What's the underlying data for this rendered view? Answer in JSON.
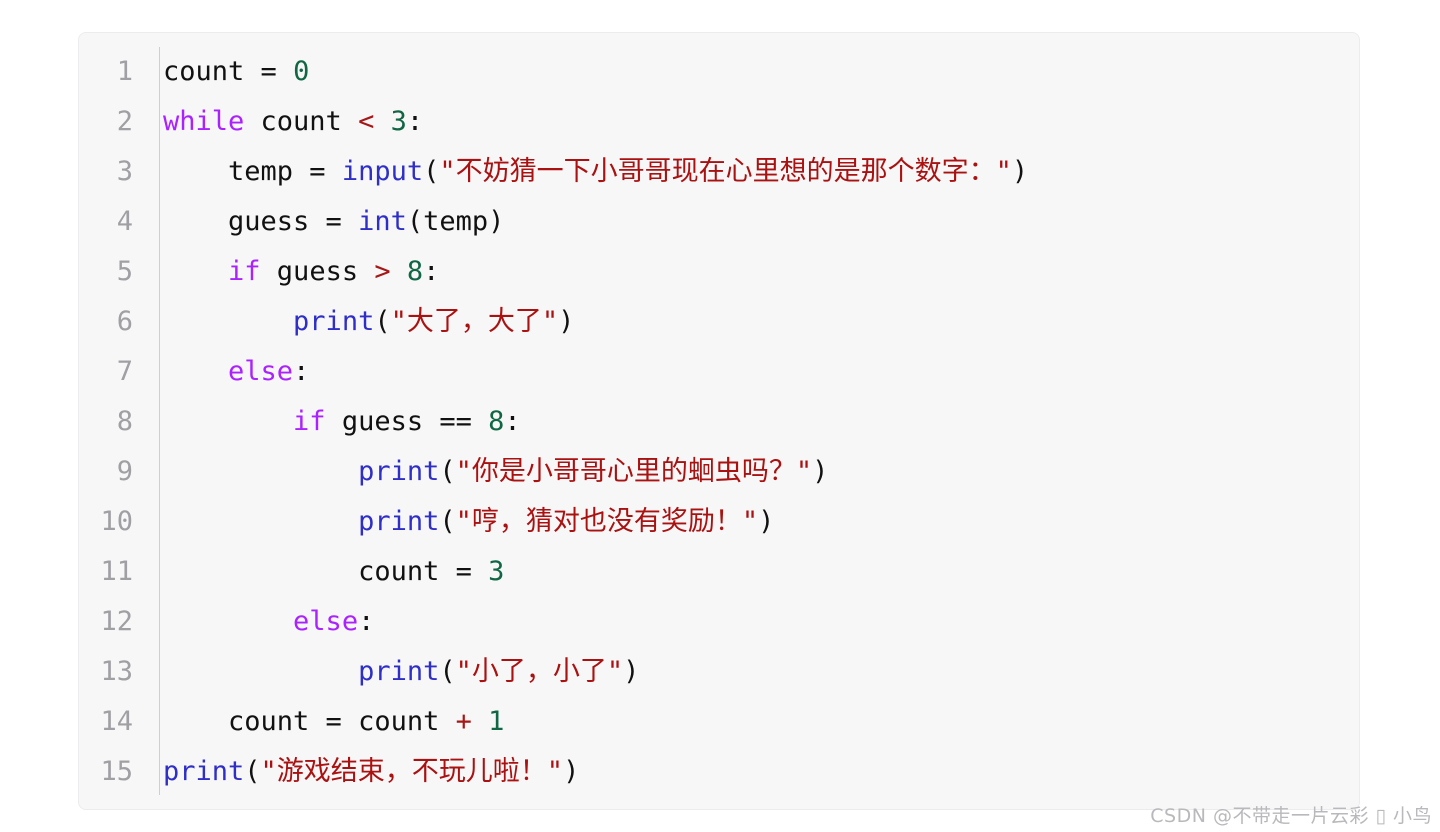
{
  "code_block": {
    "language": "python",
    "background": "#f7f7f8",
    "border_color": "#ececee",
    "gutter_divider_color": "#cfcfd2",
    "line_number_color": "#a0a0a4",
    "token_colors": {
      "keyword": "#aa22ff",
      "builtin": "#2f2fc7",
      "string": "#aa1111",
      "number": "#116644",
      "operator": "#a61717",
      "plain": "#111111"
    },
    "lines": [
      {
        "number": "1",
        "tokens": [
          {
            "t": "count",
            "k": "plain"
          },
          {
            "t": " ",
            "k": "plain"
          },
          {
            "t": "=",
            "k": "plain"
          },
          {
            "t": " ",
            "k": "plain"
          },
          {
            "t": "0",
            "k": "num"
          }
        ]
      },
      {
        "number": "2",
        "tokens": [
          {
            "t": "while",
            "k": "kw"
          },
          {
            "t": " count ",
            "k": "plain"
          },
          {
            "t": "<",
            "k": "op"
          },
          {
            "t": " ",
            "k": "plain"
          },
          {
            "t": "3",
            "k": "num"
          },
          {
            "t": ":",
            "k": "plain"
          }
        ]
      },
      {
        "number": "3",
        "tokens": [
          {
            "t": "    temp = ",
            "k": "plain"
          },
          {
            "t": "input",
            "k": "builtin"
          },
          {
            "t": "(",
            "k": "punc"
          },
          {
            "t": "\"不妨猜一下小哥哥现在心里想的是那个数字：\"",
            "k": "str"
          },
          {
            "t": ")",
            "k": "punc"
          }
        ]
      },
      {
        "number": "4",
        "tokens": [
          {
            "t": "    guess = ",
            "k": "plain"
          },
          {
            "t": "int",
            "k": "builtin"
          },
          {
            "t": "(temp)",
            "k": "punc"
          }
        ]
      },
      {
        "number": "5",
        "tokens": [
          {
            "t": "    ",
            "k": "plain"
          },
          {
            "t": "if",
            "k": "kw"
          },
          {
            "t": " guess ",
            "k": "plain"
          },
          {
            "t": ">",
            "k": "op"
          },
          {
            "t": " ",
            "k": "plain"
          },
          {
            "t": "8",
            "k": "num"
          },
          {
            "t": ":",
            "k": "plain"
          }
        ]
      },
      {
        "number": "6",
        "tokens": [
          {
            "t": "        ",
            "k": "plain"
          },
          {
            "t": "print",
            "k": "builtin"
          },
          {
            "t": "(",
            "k": "punc"
          },
          {
            "t": "\"大了，大了\"",
            "k": "str"
          },
          {
            "t": ")",
            "k": "punc"
          }
        ]
      },
      {
        "number": "7",
        "tokens": [
          {
            "t": "    ",
            "k": "plain"
          },
          {
            "t": "else",
            "k": "kw"
          },
          {
            "t": ":",
            "k": "plain"
          }
        ]
      },
      {
        "number": "8",
        "tokens": [
          {
            "t": "        ",
            "k": "plain"
          },
          {
            "t": "if",
            "k": "kw"
          },
          {
            "t": " guess ",
            "k": "plain"
          },
          {
            "t": "==",
            "k": "plain"
          },
          {
            "t": " ",
            "k": "plain"
          },
          {
            "t": "8",
            "k": "num"
          },
          {
            "t": ":",
            "k": "plain"
          }
        ]
      },
      {
        "number": "9",
        "tokens": [
          {
            "t": "            ",
            "k": "plain"
          },
          {
            "t": "print",
            "k": "builtin"
          },
          {
            "t": "(",
            "k": "punc"
          },
          {
            "t": "\"你是小哥哥心里的蛔虫吗？\"",
            "k": "str"
          },
          {
            "t": ")",
            "k": "punc"
          }
        ]
      },
      {
        "number": "10",
        "tokens": [
          {
            "t": "            ",
            "k": "plain"
          },
          {
            "t": "print",
            "k": "builtin"
          },
          {
            "t": "(",
            "k": "punc"
          },
          {
            "t": "\"哼，猜对也没有奖励！\"",
            "k": "str"
          },
          {
            "t": ")",
            "k": "punc"
          }
        ]
      },
      {
        "number": "11",
        "tokens": [
          {
            "t": "            count = ",
            "k": "plain"
          },
          {
            "t": "3",
            "k": "num"
          }
        ]
      },
      {
        "number": "12",
        "tokens": [
          {
            "t": "        ",
            "k": "plain"
          },
          {
            "t": "else",
            "k": "kw"
          },
          {
            "t": ":",
            "k": "plain"
          }
        ]
      },
      {
        "number": "13",
        "tokens": [
          {
            "t": "            ",
            "k": "plain"
          },
          {
            "t": "print",
            "k": "builtin"
          },
          {
            "t": "(",
            "k": "punc"
          },
          {
            "t": "\"小了，小了\"",
            "k": "str"
          },
          {
            "t": ")",
            "k": "punc"
          }
        ]
      },
      {
        "number": "14",
        "tokens": [
          {
            "t": "    count = count ",
            "k": "plain"
          },
          {
            "t": "+",
            "k": "op"
          },
          {
            "t": " ",
            "k": "plain"
          },
          {
            "t": "1",
            "k": "num"
          }
        ]
      },
      {
        "number": "15",
        "tokens": [
          {
            "t": "print",
            "k": "builtin"
          },
          {
            "t": "(",
            "k": "punc"
          },
          {
            "t": "\"游戏结束，不玩儿啦！\"",
            "k": "str"
          },
          {
            "t": ")",
            "k": "punc"
          }
        ]
      }
    ]
  },
  "watermark": {
    "text": "CSDN @不带走一片云彩 ▯ 小鸟",
    "color": "#b9b9bd"
  }
}
